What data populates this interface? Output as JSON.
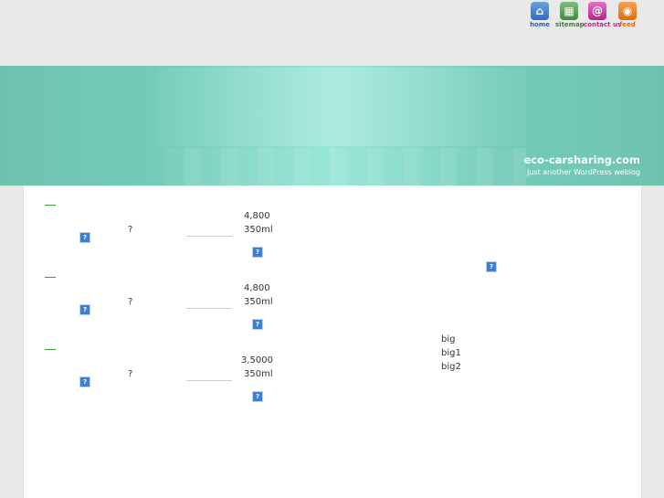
{
  "nav": {
    "home": {
      "label": "home",
      "icon": "home-icon"
    },
    "sitemap": {
      "label": "sitemap",
      "icon": "sitemap-icon"
    },
    "contact": {
      "label": "contact us",
      "icon": "contact-icon"
    },
    "feed": {
      "label": "feed",
      "icon": "rss-feed-icon"
    }
  },
  "header": {
    "site_title": "eco-carsharing.com",
    "site_description": "Just another WordPress weblog"
  },
  "products": [
    {
      "question": "?",
      "price": "4,800",
      "volume": "350ml"
    },
    {
      "question": "?",
      "price": "4,800",
      "volume": "350ml"
    },
    {
      "question": "?",
      "price": "3,5000",
      "volume": "350ml"
    }
  ],
  "broken_image_glyph": "?",
  "sidebar": {
    "links": [
      "big",
      "big1",
      "big2"
    ]
  },
  "colors": {
    "header_teal": "#74ccb8",
    "header_light": "#95e6d6",
    "dash_green": "#3a9b3a",
    "panel_bg": "#ffffff",
    "page_bg": "#e9e9e9"
  }
}
